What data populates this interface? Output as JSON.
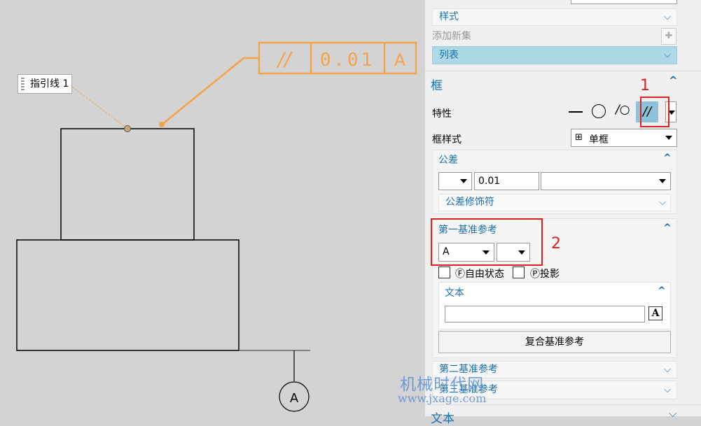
{
  "canvas": {
    "leader_label": "指引线 1",
    "fcf": {
      "symbol": "//",
      "tolerance": "0.01",
      "datum": "A"
    },
    "datum_symbol": "A",
    "watermark_cn": "机械时代网",
    "watermark_url": "www.jxage.com",
    "colors": {
      "annotation": "#f5a34a",
      "geometry": "#000000",
      "background": "#d3d3d3"
    }
  },
  "panel": {
    "top_style": "样式",
    "add_new_set": "添加新集",
    "list": "列表",
    "frame_section": "框",
    "property_label": "特性",
    "frame_style_label": "框样式",
    "frame_style_value": "单框",
    "tolerance_section": "公差",
    "tolerance_value": "0.01",
    "tolerance_modifier": "公差修饰符",
    "primary_datum": "第一基准参考",
    "primary_datum_value": "A",
    "free_state": "Ⓕ自由状态",
    "projected": "Ⓟ投影",
    "text_section": "文本",
    "composite_datum_button": "复合基准参考",
    "secondary_datum": "第二基准参考",
    "tertiary_datum": "第三基准参考",
    "text_section_bottom": "文本",
    "annotation_1": "1",
    "annotation_2": "2",
    "colors": {
      "selected_row": "#add8e6",
      "section_text": "#1a6fa8",
      "highlight": "#e02020"
    }
  }
}
